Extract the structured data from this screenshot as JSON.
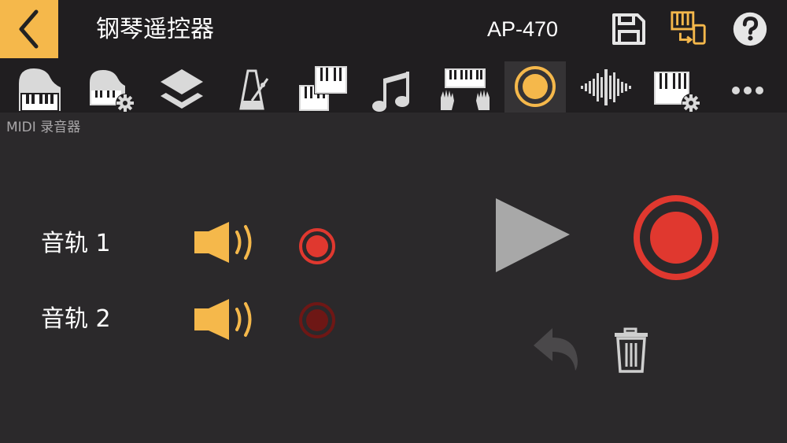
{
  "header": {
    "title": "钢琴遥控器",
    "model": "AP-470",
    "icons": [
      "back-arrow-icon",
      "save-icon",
      "device-connect-icon",
      "help-icon"
    ]
  },
  "tabs": [
    {
      "icon": "grand-piano-icon",
      "active": false
    },
    {
      "icon": "piano-settings-icon",
      "active": false
    },
    {
      "icon": "layers-icon",
      "active": false
    },
    {
      "icon": "metronome-icon",
      "active": false
    },
    {
      "icon": "dual-keyboard-icon",
      "active": false
    },
    {
      "icon": "music-note-icon",
      "active": false
    },
    {
      "icon": "hands-keyboard-icon",
      "active": false
    },
    {
      "icon": "record-circle-icon",
      "active": true
    },
    {
      "icon": "waveform-icon",
      "active": false
    },
    {
      "icon": "keyboard-settings-icon",
      "active": false
    },
    {
      "icon": "more-icon",
      "active": false
    }
  ],
  "section": {
    "label": "MIDI 录音器"
  },
  "tracks": [
    {
      "label": "音轨 1",
      "armed": true
    },
    {
      "label": "音轨 2",
      "armed": false
    }
  ],
  "colors": {
    "accent": "#f5b84b",
    "record": "#e0382f",
    "record_dim": "#6e1715",
    "background": "#2b292b",
    "bar": "#201e20"
  }
}
